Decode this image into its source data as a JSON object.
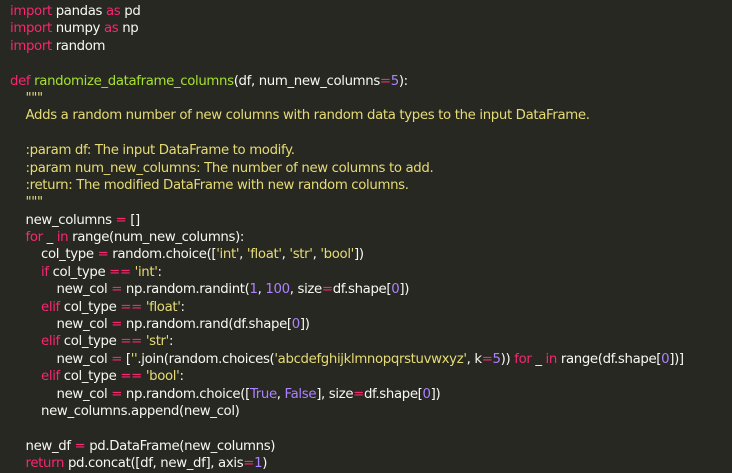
{
  "colors": {
    "background": "#272822",
    "keyword": "#f92672",
    "function": "#a6e22e",
    "string": "#e6db74",
    "number": "#ae81ff",
    "default": "#f8f8f2"
  },
  "code_lines": [
    [
      {
        "t": "import",
        "c": "keyword"
      },
      {
        "t": " pandas ",
        "c": "default"
      },
      {
        "t": "as",
        "c": "keyword"
      },
      {
        "t": " pd",
        "c": "default"
      }
    ],
    [
      {
        "t": "import",
        "c": "keyword"
      },
      {
        "t": " numpy ",
        "c": "default"
      },
      {
        "t": "as",
        "c": "keyword"
      },
      {
        "t": " np",
        "c": "default"
      }
    ],
    [
      {
        "t": "import",
        "c": "keyword"
      },
      {
        "t": " random",
        "c": "default"
      }
    ],
    [],
    [
      {
        "t": "def",
        "c": "keyword"
      },
      {
        "t": " ",
        "c": "default"
      },
      {
        "t": "randomize_dataframe_columns",
        "c": "function"
      },
      {
        "t": "(df, num_new_columns",
        "c": "default"
      },
      {
        "t": "=",
        "c": "keyword"
      },
      {
        "t": "5",
        "c": "number"
      },
      {
        "t": "):",
        "c": "default"
      }
    ],
    [
      {
        "t": "    \"\"\"",
        "c": "string"
      }
    ],
    [
      {
        "t": "    Adds a random number of new columns with random data types to the input DataFrame.",
        "c": "string"
      }
    ],
    [],
    [
      {
        "t": "    :param df: The input DataFrame to modify.",
        "c": "string"
      }
    ],
    [
      {
        "t": "    :param num_new_columns: The number of new columns to add.",
        "c": "string"
      }
    ],
    [
      {
        "t": "    :return: The modified DataFrame with new random columns.",
        "c": "string"
      }
    ],
    [
      {
        "t": "    \"\"\"",
        "c": "string"
      }
    ],
    [
      {
        "t": "    new_columns ",
        "c": "default"
      },
      {
        "t": "=",
        "c": "keyword"
      },
      {
        "t": " []",
        "c": "default"
      }
    ],
    [
      {
        "t": "    ",
        "c": "default"
      },
      {
        "t": "for",
        "c": "keyword"
      },
      {
        "t": " _ ",
        "c": "default"
      },
      {
        "t": "in",
        "c": "keyword"
      },
      {
        "t": " range(num_new_columns):",
        "c": "default"
      }
    ],
    [
      {
        "t": "        col_type ",
        "c": "default"
      },
      {
        "t": "=",
        "c": "keyword"
      },
      {
        "t": " random.choice([",
        "c": "default"
      },
      {
        "t": "'int'",
        "c": "string"
      },
      {
        "t": ", ",
        "c": "default"
      },
      {
        "t": "'float'",
        "c": "string"
      },
      {
        "t": ", ",
        "c": "default"
      },
      {
        "t": "'str'",
        "c": "string"
      },
      {
        "t": ", ",
        "c": "default"
      },
      {
        "t": "'bool'",
        "c": "string"
      },
      {
        "t": "])",
        "c": "default"
      }
    ],
    [
      {
        "t": "        ",
        "c": "default"
      },
      {
        "t": "if",
        "c": "keyword"
      },
      {
        "t": " col_type ",
        "c": "default"
      },
      {
        "t": "==",
        "c": "keyword"
      },
      {
        "t": " ",
        "c": "default"
      },
      {
        "t": "'int'",
        "c": "string"
      },
      {
        "t": ":",
        "c": "default"
      }
    ],
    [
      {
        "t": "            new_col ",
        "c": "default"
      },
      {
        "t": "=",
        "c": "keyword"
      },
      {
        "t": " np.random.randint(",
        "c": "default"
      },
      {
        "t": "1",
        "c": "number"
      },
      {
        "t": ", ",
        "c": "default"
      },
      {
        "t": "100",
        "c": "number"
      },
      {
        "t": ", size",
        "c": "default"
      },
      {
        "t": "=",
        "c": "keyword"
      },
      {
        "t": "df.shape[",
        "c": "default"
      },
      {
        "t": "0",
        "c": "number"
      },
      {
        "t": "])",
        "c": "default"
      }
    ],
    [
      {
        "t": "        ",
        "c": "default"
      },
      {
        "t": "elif",
        "c": "keyword"
      },
      {
        "t": " col_type ",
        "c": "default"
      },
      {
        "t": "==",
        "c": "keyword"
      },
      {
        "t": " ",
        "c": "default"
      },
      {
        "t": "'float'",
        "c": "string"
      },
      {
        "t": ":",
        "c": "default"
      }
    ],
    [
      {
        "t": "            new_col ",
        "c": "default"
      },
      {
        "t": "=",
        "c": "keyword"
      },
      {
        "t": " np.random.rand(df.shape[",
        "c": "default"
      },
      {
        "t": "0",
        "c": "number"
      },
      {
        "t": "])",
        "c": "default"
      }
    ],
    [
      {
        "t": "        ",
        "c": "default"
      },
      {
        "t": "elif",
        "c": "keyword"
      },
      {
        "t": " col_type ",
        "c": "default"
      },
      {
        "t": "==",
        "c": "keyword"
      },
      {
        "t": " ",
        "c": "default"
      },
      {
        "t": "'str'",
        "c": "string"
      },
      {
        "t": ":",
        "c": "default"
      }
    ],
    [
      {
        "t": "            new_col ",
        "c": "default"
      },
      {
        "t": "=",
        "c": "keyword"
      },
      {
        "t": " [",
        "c": "default"
      },
      {
        "t": "''",
        "c": "string"
      },
      {
        "t": ".join(random.choices(",
        "c": "default"
      },
      {
        "t": "'abcdefghijklmnopqrstuvwxyz'",
        "c": "string"
      },
      {
        "t": ", k",
        "c": "default"
      },
      {
        "t": "=",
        "c": "keyword"
      },
      {
        "t": "5",
        "c": "number"
      },
      {
        "t": ")) ",
        "c": "default"
      },
      {
        "t": "for",
        "c": "keyword"
      },
      {
        "t": " _ ",
        "c": "default"
      },
      {
        "t": "in",
        "c": "keyword"
      },
      {
        "t": " range(df.shape[",
        "c": "default"
      },
      {
        "t": "0",
        "c": "number"
      },
      {
        "t": "])]",
        "c": "default"
      }
    ],
    [
      {
        "t": "        ",
        "c": "default"
      },
      {
        "t": "elif",
        "c": "keyword"
      },
      {
        "t": " col_type ",
        "c": "default"
      },
      {
        "t": "==",
        "c": "keyword"
      },
      {
        "t": " ",
        "c": "default"
      },
      {
        "t": "'bool'",
        "c": "string"
      },
      {
        "t": ":",
        "c": "default"
      }
    ],
    [
      {
        "t": "            new_col ",
        "c": "default"
      },
      {
        "t": "=",
        "c": "keyword"
      },
      {
        "t": " np.random.choice([",
        "c": "default"
      },
      {
        "t": "True",
        "c": "number"
      },
      {
        "t": ", ",
        "c": "default"
      },
      {
        "t": "False",
        "c": "number"
      },
      {
        "t": "], size",
        "c": "default"
      },
      {
        "t": "=",
        "c": "keyword"
      },
      {
        "t": "df.shape[",
        "c": "default"
      },
      {
        "t": "0",
        "c": "number"
      },
      {
        "t": "])",
        "c": "default"
      }
    ],
    [
      {
        "t": "        new_columns.append(new_col)",
        "c": "default"
      }
    ],
    [],
    [
      {
        "t": "    new_df ",
        "c": "default"
      },
      {
        "t": "=",
        "c": "keyword"
      },
      {
        "t": " pd.DataFrame(new_columns)",
        "c": "default"
      }
    ],
    [
      {
        "t": "    ",
        "c": "default"
      },
      {
        "t": "return",
        "c": "keyword"
      },
      {
        "t": " pd.concat([df, new_df], axis",
        "c": "default"
      },
      {
        "t": "=",
        "c": "keyword"
      },
      {
        "t": "1",
        "c": "number"
      },
      {
        "t": ")",
        "c": "default"
      }
    ]
  ]
}
